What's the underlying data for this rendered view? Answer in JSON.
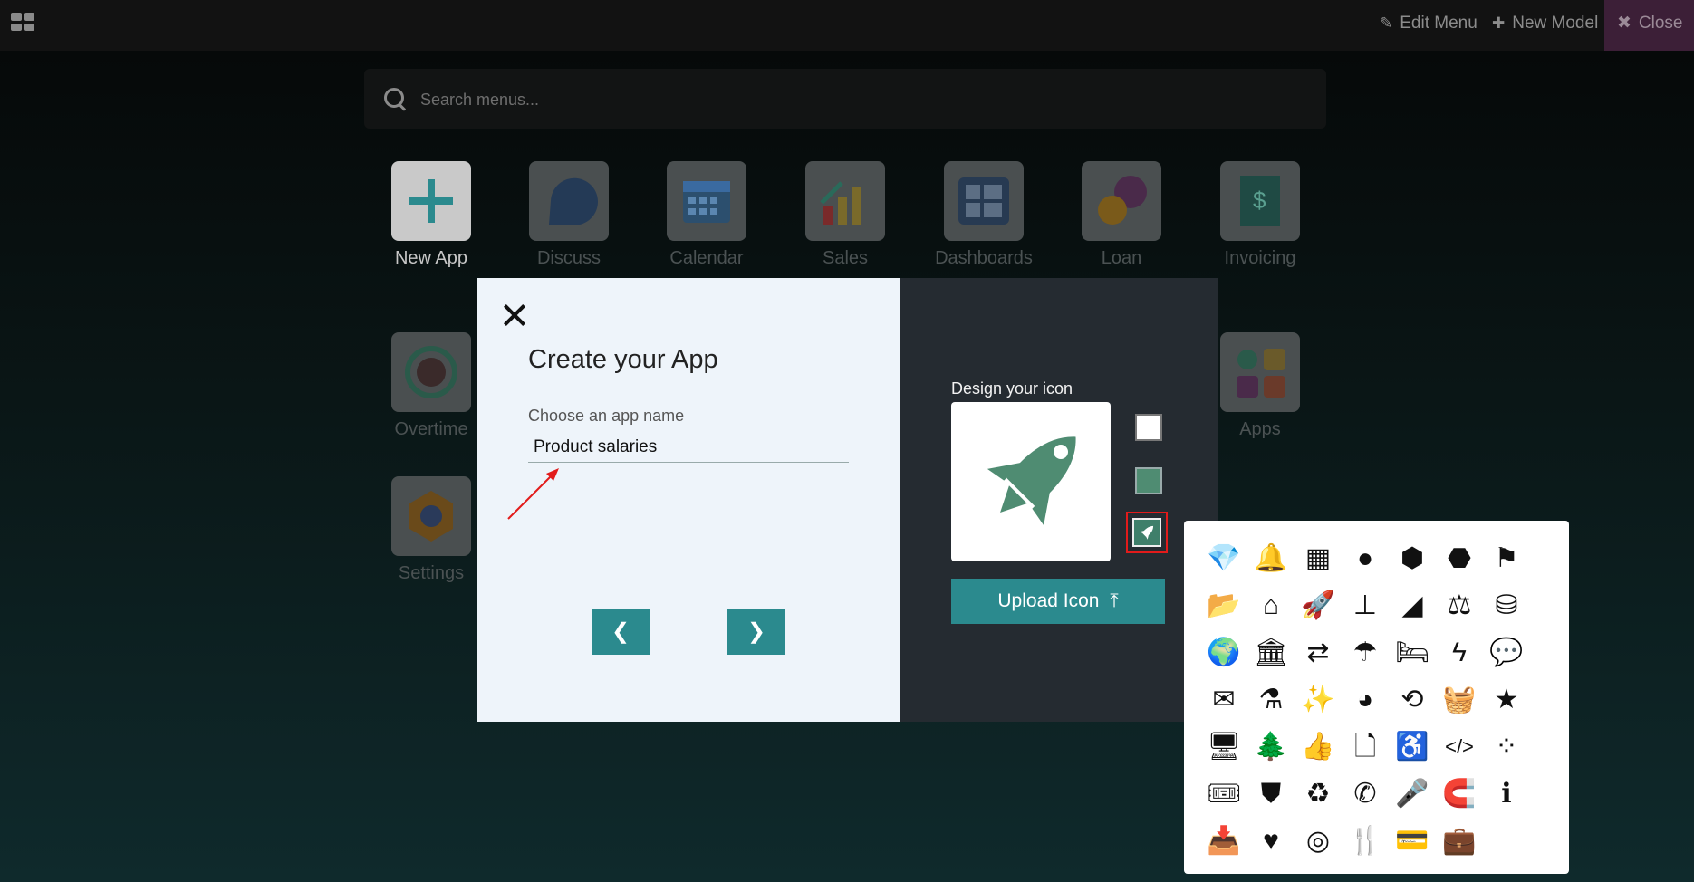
{
  "navbar": {
    "edit_menu": "Edit Menu",
    "new_model": "New Model",
    "close": "Close"
  },
  "search": {
    "placeholder": "Search menus..."
  },
  "apps": [
    {
      "label": "New App",
      "icon": "plus-icon"
    },
    {
      "label": "Discuss",
      "icon": "discuss-icon"
    },
    {
      "label": "Calendar",
      "icon": "calendar-icon"
    },
    {
      "label": "Sales",
      "icon": "sales-chart-icon"
    },
    {
      "label": "Dashboards",
      "icon": "dashboard-icon"
    },
    {
      "label": "Loan",
      "icon": "loan-icon"
    },
    {
      "label": "Invoicing",
      "icon": "invoice-icon"
    },
    {
      "label": "Overtime",
      "icon": "clock-icon"
    },
    {
      "label": "Apps",
      "icon": "apps-icon"
    },
    {
      "label": "Settings",
      "icon": "settings-icon"
    }
  ],
  "modal": {
    "title": "Create your App",
    "name_label": "Choose an app name",
    "name_value": "Product salaries",
    "prev_label": "❮",
    "next_label": "❯",
    "design_label": "Design your icon",
    "upload_label": "Upload Icon",
    "icon_bg_color": "#ffffff",
    "icon_color": "#4f8c72",
    "selected_icon": "rocket-icon"
  },
  "icon_picker": {
    "icons": [
      {
        "name": "diamond-icon",
        "glyph": "💎"
      },
      {
        "name": "bell-icon",
        "glyph": "🔔"
      },
      {
        "name": "calendar-icon",
        "glyph": "▦"
      },
      {
        "name": "circle-icon",
        "glyph": "●"
      },
      {
        "name": "cube-icon",
        "glyph": "⬢"
      },
      {
        "name": "cubes-icon",
        "glyph": "⬣"
      },
      {
        "name": "flag-icon",
        "glyph": "⚑"
      },
      {
        "name": "folder-open-icon",
        "glyph": "📂"
      },
      {
        "name": "home-icon",
        "glyph": "⌂"
      },
      {
        "name": "rocket-icon",
        "glyph": "🚀"
      },
      {
        "name": "sitemap-icon",
        "glyph": "⊥"
      },
      {
        "name": "area-chart-icon",
        "glyph": "◢"
      },
      {
        "name": "balance-scale-icon",
        "glyph": "⚖"
      },
      {
        "name": "database-icon",
        "glyph": "⛁"
      },
      {
        "name": "globe-icon",
        "glyph": "🌍"
      },
      {
        "name": "bank-icon",
        "glyph": "🏛"
      },
      {
        "name": "random-icon",
        "glyph": "⇄"
      },
      {
        "name": "umbrella-icon",
        "glyph": "☂"
      },
      {
        "name": "bed-icon",
        "glyph": "🛏"
      },
      {
        "name": "bolt-icon",
        "glyph": "ϟ"
      },
      {
        "name": "comment-dots-icon",
        "glyph": "💬"
      },
      {
        "name": "envelope-icon",
        "glyph": "✉"
      },
      {
        "name": "flask-icon",
        "glyph": "⚗"
      },
      {
        "name": "magic-icon",
        "glyph": "✨"
      },
      {
        "name": "pie-chart-icon",
        "glyph": "◕"
      },
      {
        "name": "retweet-icon",
        "glyph": "⟲"
      },
      {
        "name": "shopping-basket-icon",
        "glyph": "🧺"
      },
      {
        "name": "star-icon",
        "glyph": "★"
      },
      {
        "name": "desktop-icon",
        "glyph": "🖥"
      },
      {
        "name": "tree-icon",
        "glyph": "🌲"
      },
      {
        "name": "thumbs-up-icon",
        "glyph": "👍"
      },
      {
        "name": "file-icon",
        "glyph": "🗋"
      },
      {
        "name": "wheelchair-icon",
        "glyph": "♿"
      },
      {
        "name": "code-icon",
        "glyph": "</>"
      },
      {
        "name": "spinner-icon",
        "glyph": "⁘"
      },
      {
        "name": "ticket-icon",
        "glyph": "🎟"
      },
      {
        "name": "shield-icon",
        "glyph": "⛊"
      },
      {
        "name": "recycle-icon",
        "glyph": "♻"
      },
      {
        "name": "phone-icon",
        "glyph": "✆"
      },
      {
        "name": "microphone-icon",
        "glyph": "🎤"
      },
      {
        "name": "magnet-icon",
        "glyph": "🧲"
      },
      {
        "name": "info-icon",
        "glyph": "ℹ"
      },
      {
        "name": "inbox-icon",
        "glyph": "📥"
      },
      {
        "name": "heart-icon",
        "glyph": "♥"
      },
      {
        "name": "bullseye-icon",
        "glyph": "◎"
      },
      {
        "name": "cutlery-icon",
        "glyph": "🍴"
      },
      {
        "name": "credit-card-icon",
        "glyph": "💳"
      },
      {
        "name": "briefcase-icon",
        "glyph": "💼"
      }
    ]
  }
}
